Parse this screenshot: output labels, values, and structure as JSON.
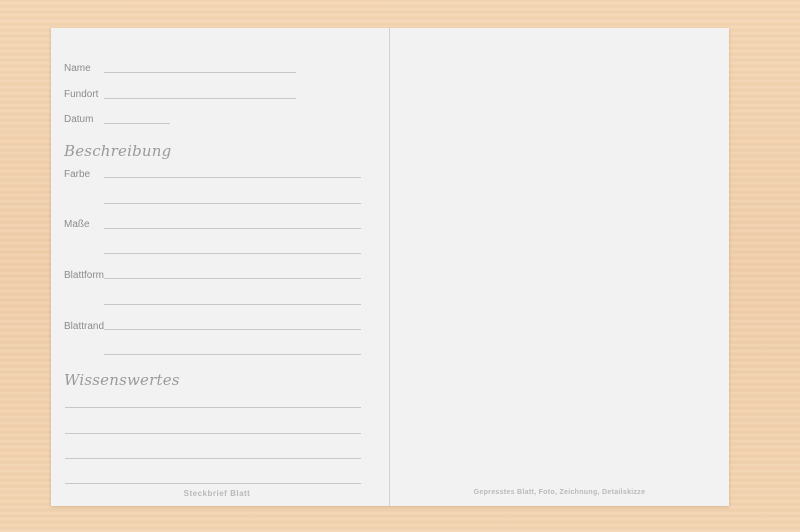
{
  "fields": {
    "name": "Name",
    "fundort": "Fundort",
    "datum": "Datum"
  },
  "beschreibung": {
    "heading": "Beschreibung",
    "farbe": "Farbe",
    "masse": "Maße",
    "blattform": "Blattform",
    "blattrand": "Blattrand"
  },
  "wissenswertes": {
    "heading": "Wissenswertes"
  },
  "footer": {
    "left": "Steckbrief Blatt",
    "right": "Gepresstes Blatt, Foto, Zeichnung, Detailskizze"
  }
}
